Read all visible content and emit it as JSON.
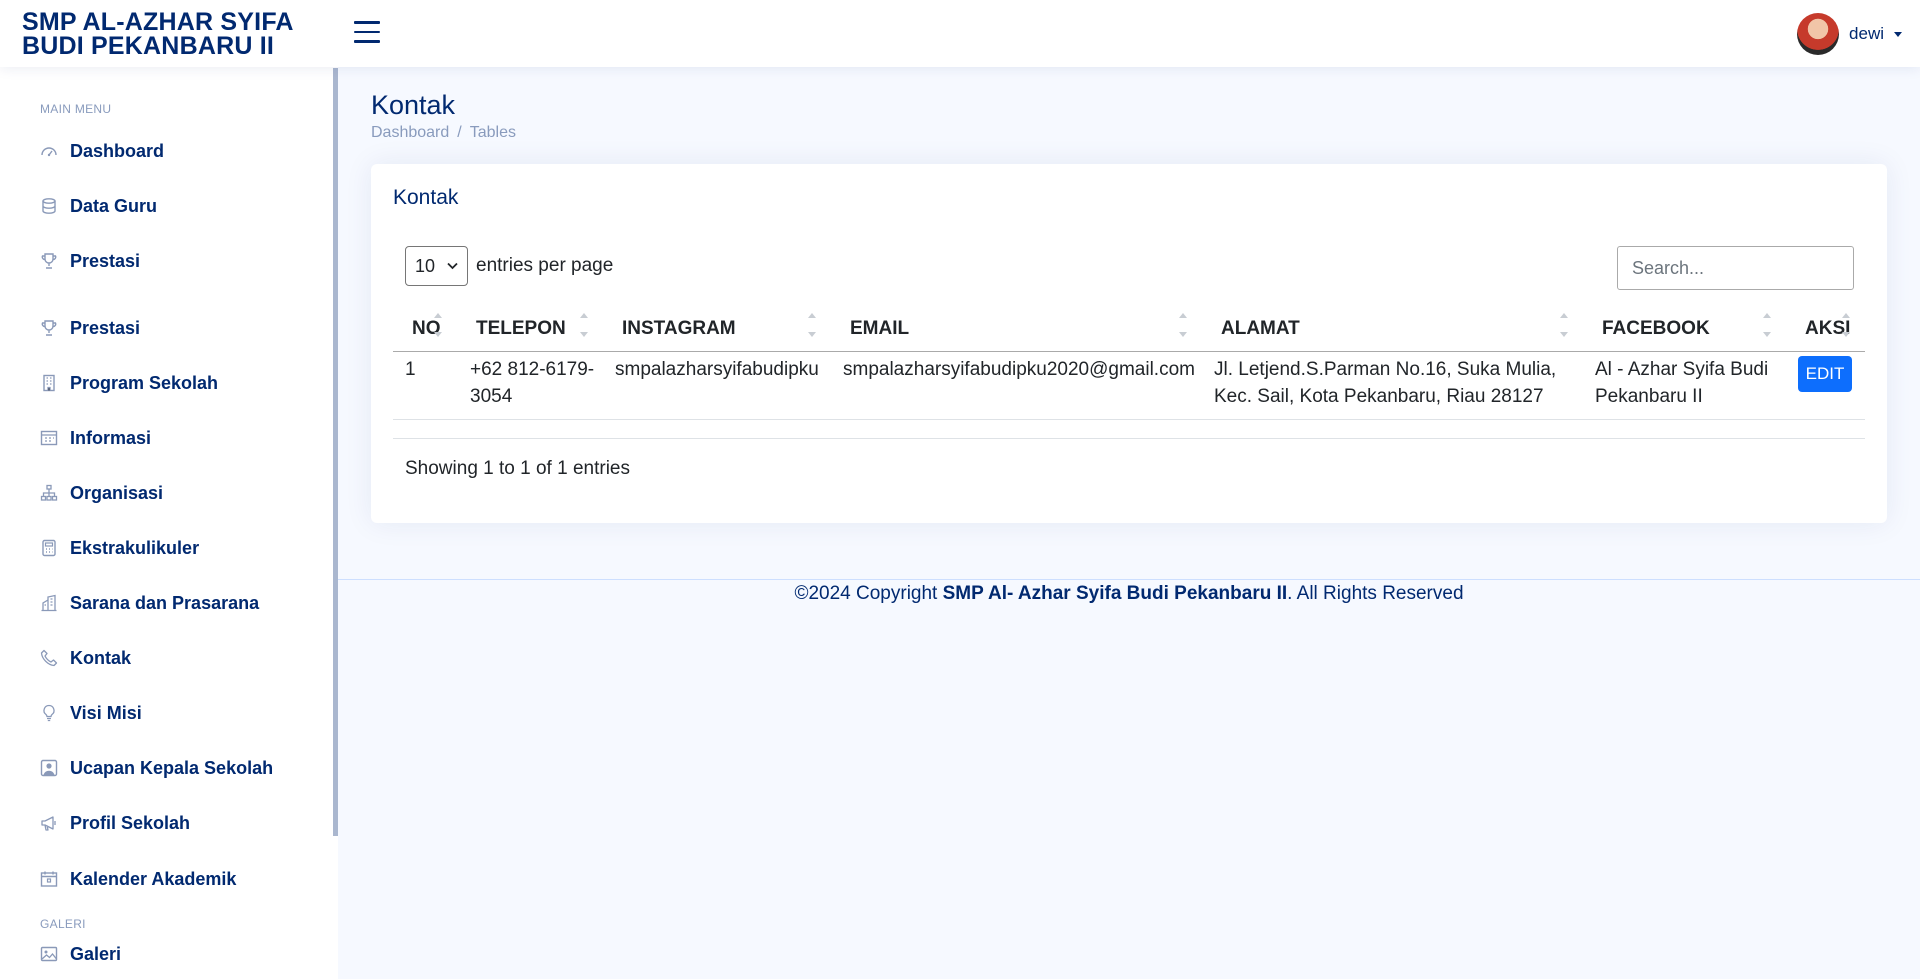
{
  "header": {
    "brand_line1": "SMP AL-AZHAR SYIFA",
    "brand_line2": "BUDI PEKANBARU II",
    "user_name": "dewi"
  },
  "sidebar": {
    "section_main": "MAIN MENU",
    "items": [
      {
        "label": "Dashboard",
        "icon": "speedometer-icon"
      },
      {
        "label": "Data Guru",
        "icon": "database-icon"
      },
      {
        "label": "Prestasi",
        "icon": "trophy-icon"
      },
      {
        "label": "Prestasi",
        "icon": "trophy-icon"
      },
      {
        "label": "Program Sekolah",
        "icon": "building-icon"
      },
      {
        "label": "Informasi",
        "icon": "calendar-grid-icon"
      },
      {
        "label": "Organisasi",
        "icon": "diagram-icon"
      },
      {
        "label": "Ekstrakulikuler",
        "icon": "calculator-icon"
      },
      {
        "label": "Sarana dan Prasarana",
        "icon": "buildings-icon"
      },
      {
        "label": "Kontak",
        "icon": "telephone-icon"
      },
      {
        "label": "Visi Misi",
        "icon": "lightbulb-icon"
      },
      {
        "label": "Ucapan Kepala Sekolah",
        "icon": "person-square-icon"
      },
      {
        "label": "Profil Sekolah",
        "icon": "megaphone-icon"
      },
      {
        "label": "Kalender Akademik",
        "icon": "calendar-icon"
      }
    ],
    "section_gallery": "GALERI",
    "gallery_items": [
      {
        "label": "Galeri",
        "icon": "image-icon"
      }
    ]
  },
  "page": {
    "title": "Kontak",
    "breadcrumb": [
      "Dashboard",
      "Tables"
    ],
    "breadcrumb_sep": "/"
  },
  "card": {
    "title": "Kontak",
    "per_page_value": "10",
    "per_page_label": "entries per page",
    "search_placeholder": "Search...",
    "columns": [
      "NO",
      "TELEPON",
      "INSTAGRAM",
      "EMAIL",
      "ALAMAT",
      "FACEBOOK",
      "AKSI"
    ],
    "rows": [
      {
        "no": "1",
        "telepon": [
          "+62 812-6179-",
          "3054"
        ],
        "instagram": "smpalazharsyifabudipku",
        "email": "smpalazharsyifabudipku2020@gmail.com",
        "alamat": [
          "Jl. Letjend.S.Parman No.16, Suka Mulia,",
          "Kec. Sail, Kota Pekanbaru, Riau 28127"
        ],
        "facebook": [
          "Al - Azhar Syifa Budi",
          "Pekanbaru II"
        ],
        "action": "EDIT"
      }
    ],
    "info": "Showing 1 to 1 of 1 entries"
  },
  "footer": {
    "prefix": "©2024 Copyright ",
    "org": "SMP Al- Azhar Syifa Budi Pekanbaru II",
    "suffix": ". All Rights Reserved"
  },
  "colors": {
    "primary": "#012970",
    "muted": "#899bbd",
    "button": "#0d6efd",
    "background": "#f6f9ff"
  }
}
